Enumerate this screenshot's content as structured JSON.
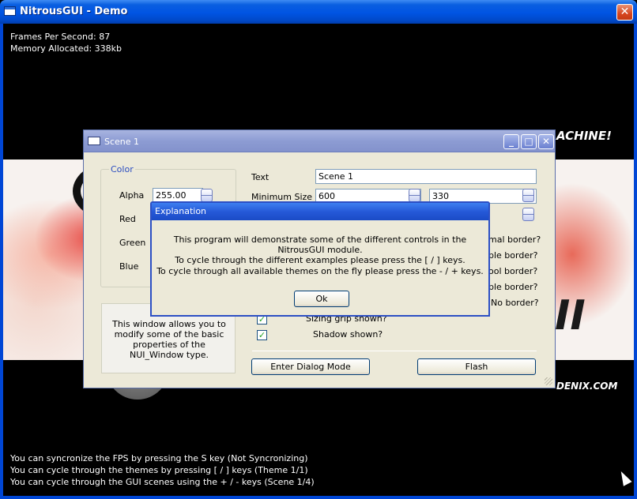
{
  "app": {
    "title": "NitrousGUI - Demo",
    "close_glyph": "✕"
  },
  "hud": {
    "fps": "Frames Per Second: 87",
    "memory": "Memory Allocated: 338kb",
    "hint_sync": "You can syncronize the FPS by pressing the S key (Not Syncronizing)",
    "hint_theme": "You can cycle through the themes by pressing [ / ] keys (Theme 1/1)",
    "hint_scene": "You can cycle through the GUI scenes using the + / - keys (Scene 1/4)"
  },
  "background": {
    "logo_top": "ACHINE!",
    "logo_bottom": "DENIX.COM",
    "big_glyph": "II"
  },
  "scene_window": {
    "title": "Scene 1",
    "buttons": {
      "minimize": "_",
      "maximize": "□",
      "close": "✕"
    },
    "color_group": {
      "legend": "Color",
      "alpha_label": "Alpha",
      "alpha_value": "255.00",
      "red_label": "Red",
      "green_label": "Green",
      "blue_label": "Blue"
    },
    "description": "This window allows you to modify some of the basic properties of the NUI_Window type.",
    "text_label": "Text",
    "text_value": "Scene 1",
    "min_size_label": "Minimum Size",
    "min_w": "600",
    "min_h": "330",
    "border_options": [
      "mal border?",
      "ble border?",
      "ool border?",
      "ble border?",
      "No border?"
    ],
    "sizing_grip_label": "Sizing grip shown?",
    "shadow_label": "Shadow shown?",
    "sizing_grip_checked": true,
    "shadow_checked": true,
    "check_glyph": "✓",
    "dialog_mode_button": "Enter Dialog Mode",
    "flash_button": "Flash"
  },
  "dialog": {
    "title": "Explanation",
    "line1": "This program will demonstrate some of the different controls in the NitrousGUI module.",
    "line2": "To cycle through the different examples please press the [ / ] keys.",
    "line3": "To cycle through all available themes on the fly please press the - / + keys.",
    "ok_button": "Ok"
  }
}
